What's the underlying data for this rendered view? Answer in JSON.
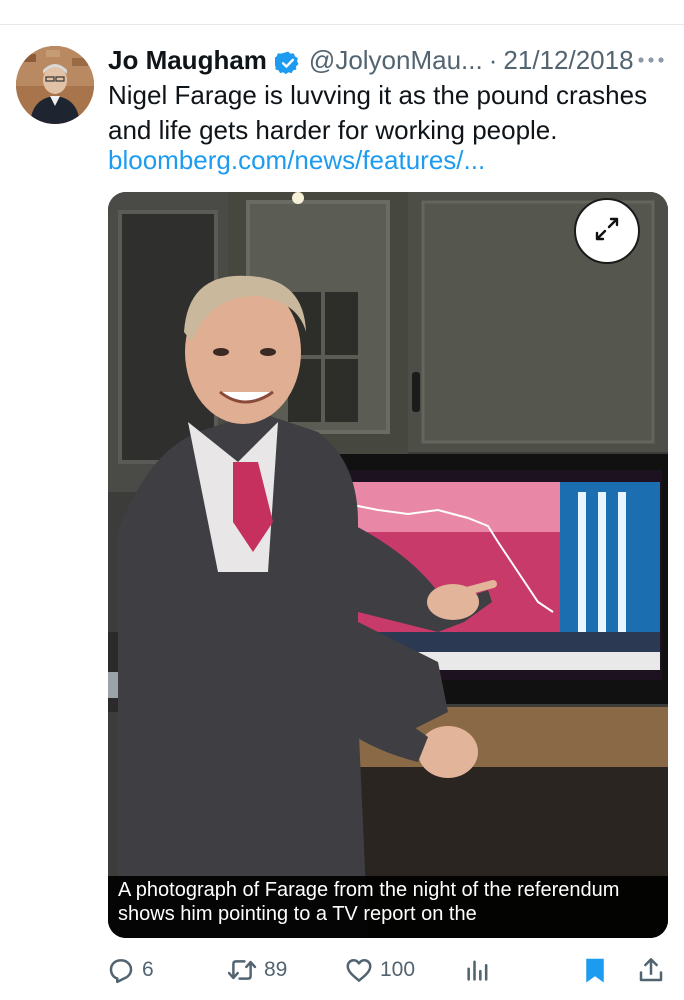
{
  "tweet": {
    "author": {
      "display_name": "Jo Maugham",
      "handle": "@JolyonMau...",
      "verified": true,
      "avatar_icon": "profile-photo"
    },
    "separator": "·",
    "date": "21/12/2018",
    "text": "Nigel Farage is luvving it as the pound crashes and life gets harder for working people.",
    "link": "bloomberg.com/news/features/...",
    "media": {
      "caption": "A photograph of Farage from the night of the referendum shows him pointing to a TV report on the"
    },
    "actions": {
      "replies": "6",
      "reposts": "89",
      "likes": "100"
    }
  },
  "icons": {
    "verified": "verified-badge-icon",
    "more": "more-options-icon",
    "expand": "expand-icon",
    "reply": "reply-icon",
    "repost": "repost-icon",
    "like": "heart-icon",
    "views": "views-chart-icon",
    "bookmark": "bookmark-filled-icon",
    "share": "share-icon"
  },
  "colors": {
    "accent": "#1d9bf0",
    "text_primary": "#0f1419",
    "text_secondary": "#536471"
  }
}
